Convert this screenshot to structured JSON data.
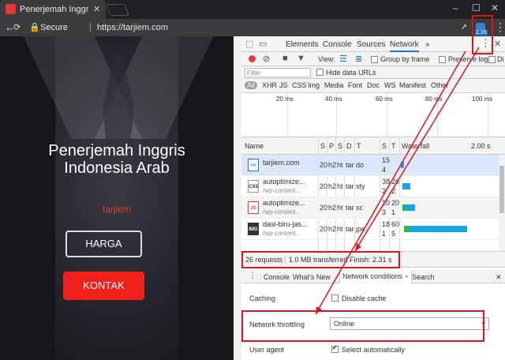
{
  "tab": {
    "title": "Penerjemah Inggris Indo"
  },
  "address": {
    "secure_label": "Secure",
    "url": "https://tarjiem.com"
  },
  "extension": {
    "badge": "2.26"
  },
  "website": {
    "title_line1": "Penerjemah Inggris",
    "title_line2": "Indonesia Arab",
    "subtitle": "tarjiem",
    "harga": "HARGA",
    "kontak": "KONTAK"
  },
  "devtools": {
    "tabs": [
      "Elements",
      "Console",
      "Sources",
      "Network"
    ],
    "active_tab": "Network",
    "more": "»",
    "toolbar": {
      "view_label": "View:",
      "group_by_frame": "Group by frame",
      "preserve_log": "Preserve log",
      "disable_cache_short": "Di"
    },
    "filter_placeholder": "Filter",
    "hide_data_urls": "Hide data URLs",
    "types": [
      "All",
      "XHR",
      "JS",
      "CSS",
      "Img",
      "Media",
      "Font",
      "Doc",
      "WS",
      "Manifest",
      "Other"
    ],
    "overview_ticks": [
      "20 ms",
      "40 ms",
      "60 ms",
      "80 ms",
      "100 ms"
    ],
    "columns": {
      "name": "Name",
      "s": "S",
      "p": "P",
      "s2": "S",
      "d": "D",
      "t": "T",
      "s3": "S",
      "t2": "T",
      "waterfall": "Waterfall",
      "wf_time": "2.00 s"
    },
    "rows": [
      {
        "name": "tarjiem.com",
        "path": "",
        "icon": "<>",
        "icon_color": "#1a73e8",
        "c1": "20",
        "c2": "h2",
        "c3": "ht",
        "c4": "tar",
        "c5": "do",
        "size_a": "15",
        "size_b": "4",
        "time_a": "",
        "time_b": ""
      },
      {
        "name": "autoptimize...",
        "path": "/wp-content...",
        "icon": "CSS",
        "icon_color": "#4a4a4a",
        "c1": "20",
        "c2": "h2",
        "c3": "ht",
        "c4": "tar",
        "c5": "sty",
        "size_a": "38",
        "size_b": "2",
        "time_a": "26",
        "time_b": "2"
      },
      {
        "name": "autoptimize...",
        "path": "/wp-content...",
        "icon": "JS",
        "icon_color": "#e53935",
        "c1": "20",
        "c2": "h2",
        "c3": "ht",
        "c4": "tar",
        "c5": "sc",
        "size_a": "10",
        "size_b": "3",
        "time_a": "20",
        "time_b": "1"
      },
      {
        "name": "dasi-biru-jas...",
        "path": "/wp-content...",
        "icon": "IMG",
        "icon_color": "#222",
        "c1": "20",
        "c2": "h2",
        "c3": "ht",
        "c4": "tar",
        "c5": "jpe",
        "size_a": "18",
        "size_b": "1",
        "time_a": "60",
        "time_b": "5"
      }
    ],
    "status": {
      "requests": "26 requests",
      "transferred": "1.0 MB transferred",
      "finish": "Finish: 2.31 s"
    },
    "drawer_tabs": [
      "Console",
      "What's New",
      "Network conditions",
      "Search"
    ],
    "drawer_active": "Network conditions",
    "drawer_close": "×",
    "caching_label": "Caching",
    "disable_cache": "Disable cache",
    "throttling_label": "Network throttling",
    "throttling_value": "Online",
    "user_agent_label": "User agent",
    "select_automatically": "Select automatically"
  },
  "colors": {
    "annotation_red": "#e1131b",
    "waterfall_blue": "#1aa3e8",
    "waterfall_green": "#2fb84b"
  }
}
